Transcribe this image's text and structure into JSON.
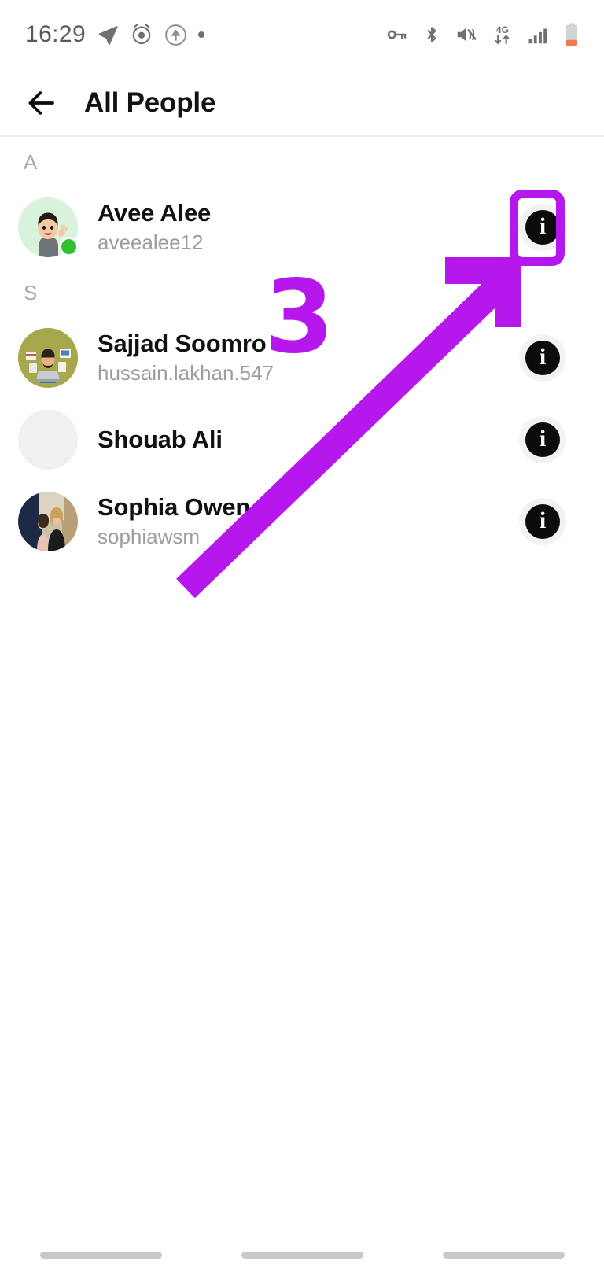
{
  "status_bar": {
    "time": "16:29",
    "left_icons": [
      "telegram-send-icon",
      "alarm-clock-icon",
      "app-badge-icon",
      "dot-indicator"
    ],
    "right_icons": [
      "vpn-key-icon",
      "bluetooth-icon",
      "vibrate-mute-icon",
      "mobile-data-4g-icon",
      "signal-bars-icon",
      "battery-low-icon"
    ],
    "network_label": "4G",
    "battery_color": "#f4764a"
  },
  "app_bar": {
    "back_label": "Back",
    "title": "All People"
  },
  "list": {
    "sections": [
      {
        "letter": "A",
        "rows": [
          {
            "name": "Avee Alee",
            "username": "aveealee12",
            "avatar": "memoji-avatar",
            "online": true,
            "info_label": "i"
          }
        ]
      },
      {
        "letter": "S",
        "rows": [
          {
            "name": "Sajjad Soomro",
            "username": "hussain.lakhan.547",
            "avatar": "illustration-avatar",
            "online": false,
            "info_label": "i"
          },
          {
            "name": "Shouab Ali",
            "username": "",
            "avatar": "placeholder-avatar",
            "online": false,
            "info_label": "i"
          },
          {
            "name": "Sophia Owen",
            "username": "sophiawsm",
            "avatar": "photo-avatar",
            "online": false,
            "info_label": "i"
          }
        ]
      }
    ]
  },
  "annotations": {
    "step_number": "3",
    "accent_color": "#b617ec",
    "highlight_target": "info-button-avee-alee",
    "arrow": "arrow-pointing-up-right"
  },
  "nav_bar": {
    "items": [
      "recents-pill",
      "home-pill",
      "back-pill"
    ]
  }
}
